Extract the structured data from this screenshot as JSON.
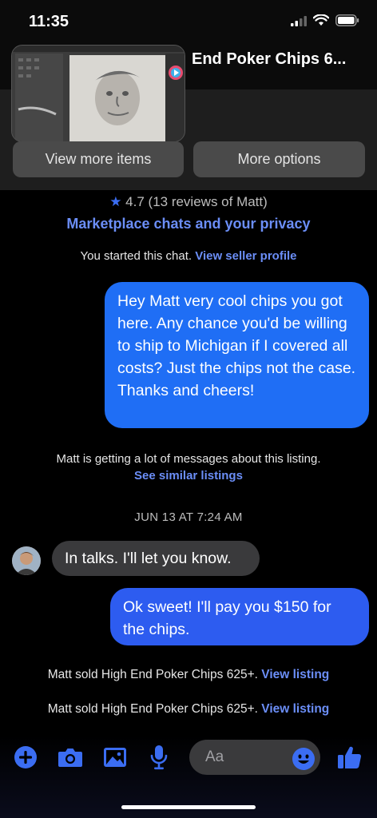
{
  "status_bar": {
    "time": "11:35"
  },
  "listing": {
    "title": "End Poker Chips 6...",
    "view_more_items": "View more items",
    "more_options": "More options"
  },
  "seller": {
    "rating_text": "4.7 (13 reviews of Matt)",
    "privacy_link": "Marketplace chats and your privacy",
    "started_text": "You started this chat.",
    "view_profile_link": "View seller profile"
  },
  "messages": {
    "outgoing_1": "Hey Matt very cool chips you got here. Any chance you'd be willing to ship to Michigan if I covered all costs? Just the chips not the case. Thanks and cheers!",
    "notice_text": "Matt is getting a lot of messages about this listing.",
    "notice_link": "See similar listings",
    "date_separator": "JUN 13 AT 7:24 AM",
    "incoming_1": "In talks. I'll let you know.",
    "outgoing_2": "Ok sweet! I'll pay you $150 for the chips.",
    "sold_1_text": "Matt sold High End Poker Chips 625+.",
    "sold_1_link": "View listing",
    "sold_2_text": "Matt sold High End Poker Chips 625+.",
    "sold_2_link": "View listing"
  },
  "composer": {
    "placeholder": "Aa",
    "icons": [
      "plus-circle-icon",
      "camera-icon",
      "photo-icon",
      "microphone-icon",
      "emoji-icon",
      "thumbs-up-icon"
    ]
  },
  "colors": {
    "accent": "#3b6df2",
    "outgoing_bubble": "#1f6ef5",
    "incoming_bubble": "#3a3a3c",
    "link": "#6b8ef7"
  }
}
